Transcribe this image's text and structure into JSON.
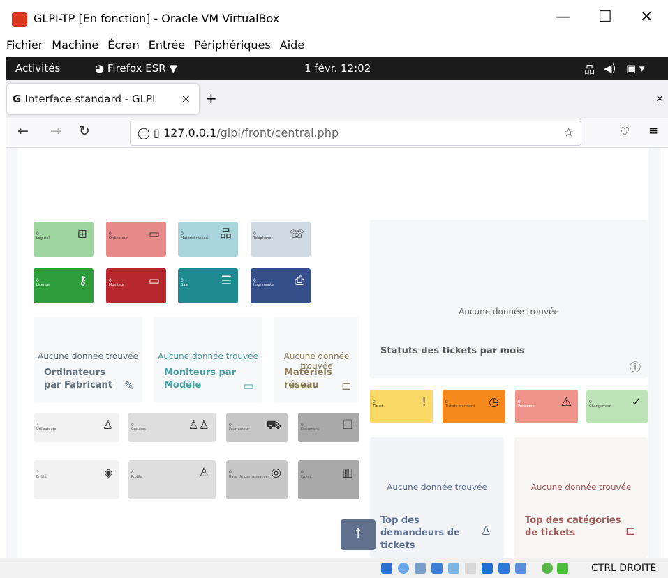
{
  "window": {
    "title": "GLPI-TP [En fonction] - Oracle VM VirtualBox",
    "menu": [
      "Fichier",
      "Machine",
      "Écran",
      "Entrée",
      "Périphériques",
      "Aide"
    ]
  },
  "gnome": {
    "activities": "Activités",
    "app": "Firefox ESR ▼",
    "clock": "1 févr. 12:02"
  },
  "browser": {
    "tab": "Interface standard - GLPI",
    "tab_close": "×",
    "new_tab": "+",
    "close_all": "×",
    "url_host": "127.0.0.1",
    "url_path": "/glpi/front/central.php"
  },
  "tiles": [
    {
      "n": "0",
      "label": "Logiciel",
      "color": "#9fd6a0",
      "icon": "⊞"
    },
    {
      "n": "0",
      "label": "Ordinateur",
      "color": "#e88a8a",
      "icon": "▭"
    },
    {
      "n": "0",
      "label": "Matériel réseau",
      "color": "#a9d5dd",
      "icon": "品"
    },
    {
      "n": "0",
      "label": "Téléphone",
      "color": "#cfd9e4",
      "icon": "☏"
    },
    {
      "n": "0",
      "label": "Licence",
      "color": "#2e9e3d",
      "icon": "⚷"
    },
    {
      "n": "0",
      "label": "Moniteur",
      "color": "#b5262d",
      "icon": "▭"
    },
    {
      "n": "0",
      "label": "Baie",
      "color": "#1f8a8f",
      "icon": "☰"
    },
    {
      "n": "0",
      "label": "Imprimante",
      "color": "#354f8b",
      "icon": "⎙"
    }
  ],
  "cards_left": [
    {
      "empty": "Aucune donnée trouvée",
      "title": "Ordinateurs par Fabricant",
      "color": "#5f6f7e",
      "icon": "✎"
    },
    {
      "empty": "Aucune donnée trouvée",
      "title": "Moniteurs par Modèle",
      "color": "#4a9ea6",
      "icon": "▭"
    },
    {
      "empty": "Aucune donnée trouvée",
      "title": "Matériels réseau",
      "color": "#8b7a55",
      "icon": "⊏"
    }
  ],
  "admin_tiles": [
    {
      "n": "4",
      "label": "Utilisateurs",
      "color": "#f2f2f2",
      "icon": "♙"
    },
    {
      "n": "0",
      "label": "Groupes",
      "color": "#dedede",
      "icon": "♙♙"
    },
    {
      "n": "0",
      "label": "Fournisseur",
      "color": "#c6c6c6",
      "icon": "⛟"
    },
    {
      "n": "0",
      "label": "Document",
      "color": "#a9a9a9",
      "icon": "❐"
    },
    {
      "n": "1",
      "label": "Entité",
      "color": "#f2f2f2",
      "icon": "◈"
    },
    {
      "n": "8",
      "label": "Profils",
      "color": "#dedede",
      "icon": "♙"
    },
    {
      "n": "0",
      "label": "Base de connaissances",
      "color": "#c6c6c6",
      "icon": "◎"
    },
    {
      "n": "0",
      "label": "Projet",
      "color": "#a9a9a9",
      "icon": "▥"
    }
  ],
  "tickets_card": {
    "empty": "Aucune donnée trouvée",
    "title": "Statuts des tickets par mois"
  },
  "ticket_tiles": [
    {
      "n": "0",
      "label": "Ticket",
      "color": "#fbd966",
      "icon": "!"
    },
    {
      "n": "0",
      "label": "Tickets en retard",
      "color": "#f68a1c",
      "icon": "◷"
    },
    {
      "n": "0",
      "label": "Problème",
      "color": "#f0938a",
      "icon": "⚠"
    },
    {
      "n": "0",
      "label": "Changement",
      "color": "#bfe3b8",
      "icon": "✓"
    }
  ],
  "bottom_cards": [
    {
      "empty": "Aucune donnée trouvée",
      "title": "Top des demandeurs de tickets",
      "color": "#5b6f93",
      "icon": "♙"
    },
    {
      "empty": "Aucune donnée trouvée",
      "title": "Top des catégories de tickets",
      "color": "#a05a5a",
      "icon": "⊏"
    }
  ],
  "scroll_top": "↑",
  "status": {
    "hostkey": "CTRL DROITE"
  }
}
